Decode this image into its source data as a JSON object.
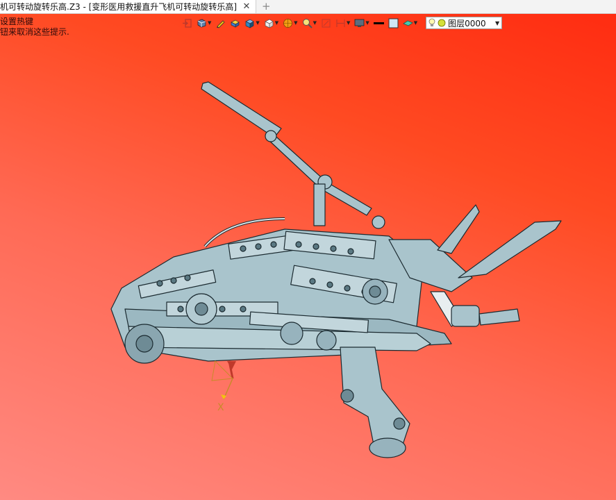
{
  "tab": {
    "title": "机可转动旋转乐高.Z3 - [变形医用救援直升飞机可转动旋转乐高]",
    "close_icon": "close-icon",
    "add_icon": "add-tab-icon"
  },
  "hint": {
    "line1": "设置热键",
    "line2": "钮来取消这些提示."
  },
  "toolbar": {
    "items": [
      {
        "name": "exit-icon",
        "caret": false
      },
      {
        "name": "view-mode-icon",
        "caret": true
      },
      {
        "name": "pen-icon",
        "caret": false
      },
      {
        "name": "shade-icon",
        "caret": false
      },
      {
        "name": "solid-box-icon",
        "caret": true
      },
      {
        "name": "wire-box-icon",
        "caret": true
      },
      {
        "name": "sphere-icon",
        "caret": true
      },
      {
        "name": "zoom-icon",
        "caret": true
      },
      {
        "name": "fit-view-icon",
        "caret": false
      },
      {
        "name": "dimension-icon",
        "caret": true
      },
      {
        "name": "display-icon",
        "caret": true
      },
      {
        "name": "line-color-icon",
        "caret": false
      },
      {
        "name": "fill-color-icon",
        "caret": false
      },
      {
        "name": "plane-icon",
        "caret": true
      }
    ],
    "layer": {
      "name": "图层0000",
      "bulb_icon": "lightbulb-icon",
      "dot_icon": "layer-color-icon"
    }
  },
  "axis": {
    "label": "X"
  },
  "colors": {
    "background_top": "#ff2a10",
    "background_bottom": "#ff8a82",
    "model": "#a9c4cc",
    "model_edge": "#1b2a30",
    "axis": "#c98a2a"
  }
}
